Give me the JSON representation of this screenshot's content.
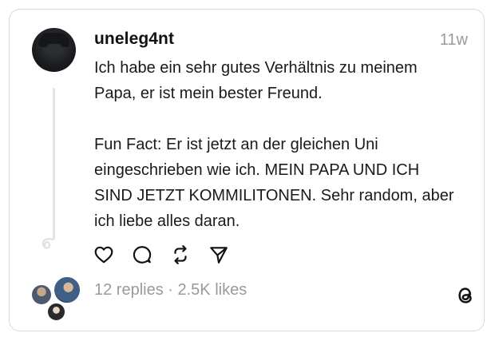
{
  "post": {
    "username": "uneleg4nt",
    "timestamp": "11w",
    "paragraph_1": "Ich habe ein sehr gutes Verhältnis zu meinem Papa, er ist mein bester Freund.",
    "paragraph_2": "Fun Fact: Er ist jetzt an der gleichen Uni eingeschrieben wie ich. MEIN PAPA UND ICH SIND JETZT KOMMILITONEN. Sehr random, aber ich liebe alles daran.",
    "stats": "12 replies · 2.5K likes"
  },
  "icons": {
    "like": "heart-icon",
    "reply": "comment-icon",
    "repost": "repost-icon",
    "share": "send-icon",
    "thread_loop": "loop-icon",
    "brand": "threads-logo-icon"
  },
  "colors": {
    "text": "#1a1a1a",
    "muted": "#9a9a9a",
    "border": "#d9d9d9",
    "thread_line": "#e3e3e3"
  }
}
